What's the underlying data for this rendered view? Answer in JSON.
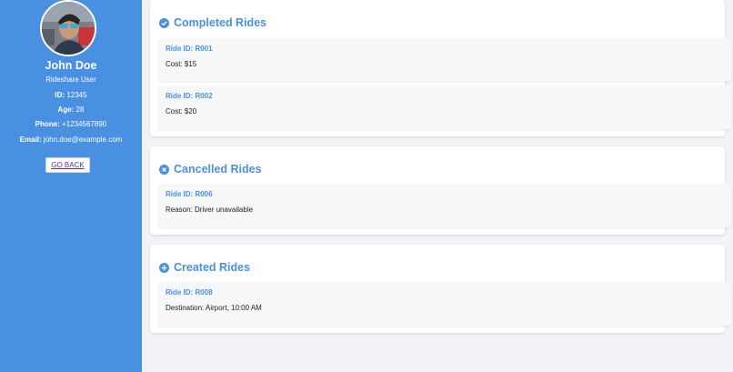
{
  "user": {
    "name": "John Doe",
    "role": "Rideshare User",
    "id_label": "ID:",
    "id_value": " 12345",
    "age_label": "Age:",
    "age_value": " 28",
    "phone_label": "Phone:",
    "phone_value": " +1234567890",
    "email_label": "Email:",
    "email_value": " john.doe@example.com",
    "go_back_label": "GO BACK"
  },
  "sections": {
    "completed": {
      "title": "Completed Rides",
      "icon": "check-circle-icon",
      "rides": [
        {
          "id": "Ride ID: R001",
          "detail": "Cost: $15"
        },
        {
          "id": "Ride ID: R002",
          "detail": "Cost: $20"
        }
      ]
    },
    "cancelled": {
      "title": "Cancelled Rides",
      "icon": "x-circle-icon",
      "rides": [
        {
          "id": "Ride ID: R006",
          "detail": "Reason: Driver unavailable"
        }
      ]
    },
    "created": {
      "title": "Created Rides",
      "icon": "plus-circle-icon",
      "rides": [
        {
          "id": "Ride ID: R008",
          "detail": "Destination: Airport, 10:00 AM"
        }
      ]
    }
  },
  "colors": {
    "sidebar": "#4a90e2",
    "accent": "#4a90e2",
    "background": "#f2f3f7",
    "card": "#f6f7f9"
  }
}
